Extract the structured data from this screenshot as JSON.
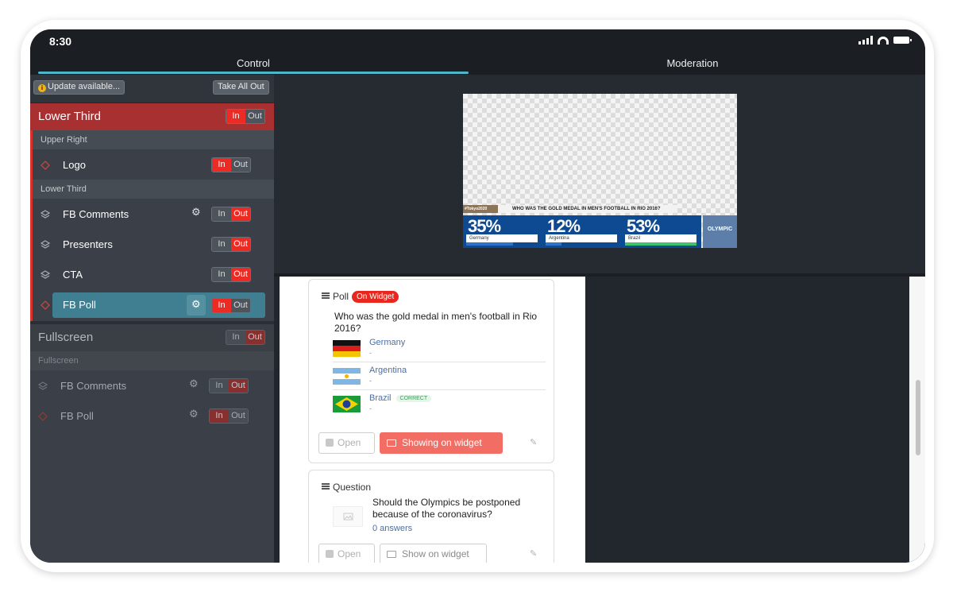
{
  "status": {
    "time": "8:30"
  },
  "tabs": [
    {
      "label": "Control"
    },
    {
      "label": "Moderation"
    }
  ],
  "toolbar": {
    "update_label": "Update available...",
    "take_all_out_label": "Take All Out"
  },
  "toggle": {
    "in": "In",
    "out": "Out"
  },
  "lower_third": {
    "title": "Lower Third",
    "groups": [
      {
        "label": "Upper Right",
        "items": [
          {
            "label": "Logo"
          }
        ]
      },
      {
        "label": "Lower Third",
        "items": [
          {
            "label": "FB Comments"
          },
          {
            "label": "Presenters"
          },
          {
            "label": "CTA"
          },
          {
            "label": "FB Poll"
          }
        ]
      }
    ]
  },
  "fullscreen": {
    "title": "Fullscreen",
    "group_label": "Fullscreen",
    "items": [
      {
        "label": "FB Comments"
      },
      {
        "label": "FB Poll"
      }
    ]
  },
  "preview": {
    "hashtag": "#Tokyo2020",
    "question": "WHO WAS THE GOLD MEDAL IN MEN'S FOOTBALL IN RIO 2016?",
    "results": [
      {
        "pct": "35%",
        "label": "Germany",
        "fraction": 0.35
      },
      {
        "pct": "12%",
        "label": "Argentina",
        "fraction": 0.12
      },
      {
        "pct": "53%",
        "label": "Brazil",
        "fraction": 0.53
      }
    ],
    "logo_text": "OLYMPIC"
  },
  "poll_card": {
    "type_label": "Poll",
    "badge": "On Widget",
    "question": "Who was the gold medal in men's football in Rio 2016?",
    "options": [
      {
        "name": "Germany",
        "sub": "-"
      },
      {
        "name": "Argentina",
        "sub": "-"
      },
      {
        "name": "Brazil",
        "sub": "-",
        "tag": "CORRECT"
      }
    ],
    "open_label": "Open",
    "widget_label": "Showing on widget"
  },
  "question_card": {
    "type_label": "Question",
    "question": "Should the Olympics be postponed because of the coronavirus?",
    "answers": "0 answers",
    "open_label": "Open",
    "widget_label": "Show on widget"
  },
  "colors": {
    "accent": "#4fb5c8",
    "live_red": "#ec2b24",
    "widget_red": "#f26e65",
    "panel": "#3b4048"
  }
}
